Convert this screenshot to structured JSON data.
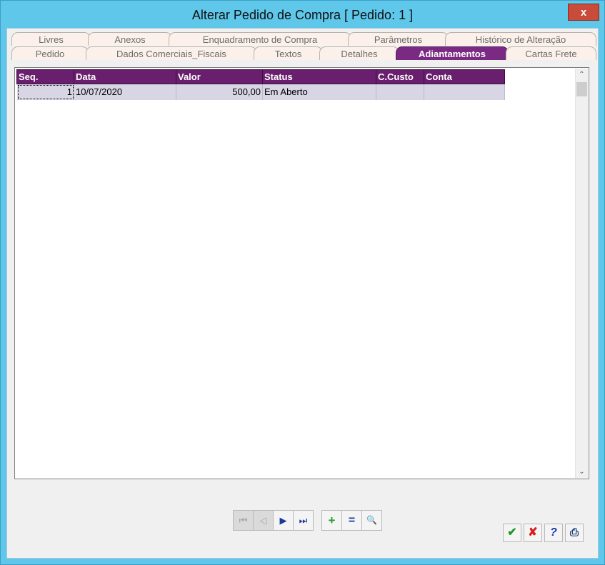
{
  "window": {
    "title": "Alterar Pedido de Compra [ Pedido: 1 ]",
    "close_label": "x"
  },
  "tabs_top": [
    "Livres",
    "Anexos",
    "Enquadramento de Compra",
    "Parâmetros",
    "Histórico de Alteração"
  ],
  "tabs_bottom": [
    "Pedido",
    "Dados Comerciais_Fiscais",
    "Textos",
    "Detalhes",
    "Adiantamentos",
    "Cartas Frete"
  ],
  "active_tab": "Adiantamentos",
  "grid": {
    "headers": [
      "Seq.",
      "Data",
      "Valor",
      "Status",
      "C.Custo",
      "Conta"
    ],
    "rows": [
      {
        "seq": "1",
        "data": "10/07/2020",
        "valor": "500,00",
        "status": "Em Aberto",
        "ccusto": "",
        "conta": ""
      }
    ]
  },
  "icons": {
    "nav_first": "⏮",
    "nav_prev": "◁",
    "nav_next": "▶",
    "nav_last": "⏭",
    "add": "+",
    "equals": "=",
    "search": "🔍",
    "ok": "✔",
    "cancel": "✘",
    "help": "?",
    "print": "⎙",
    "scroll_up": "⌃",
    "scroll_down": "⌄"
  },
  "colors": {
    "titlebar": "#5ec7ea",
    "tab_active": "#7a2a82",
    "header": "#6a1f6e",
    "row": "#d8d6e4"
  }
}
